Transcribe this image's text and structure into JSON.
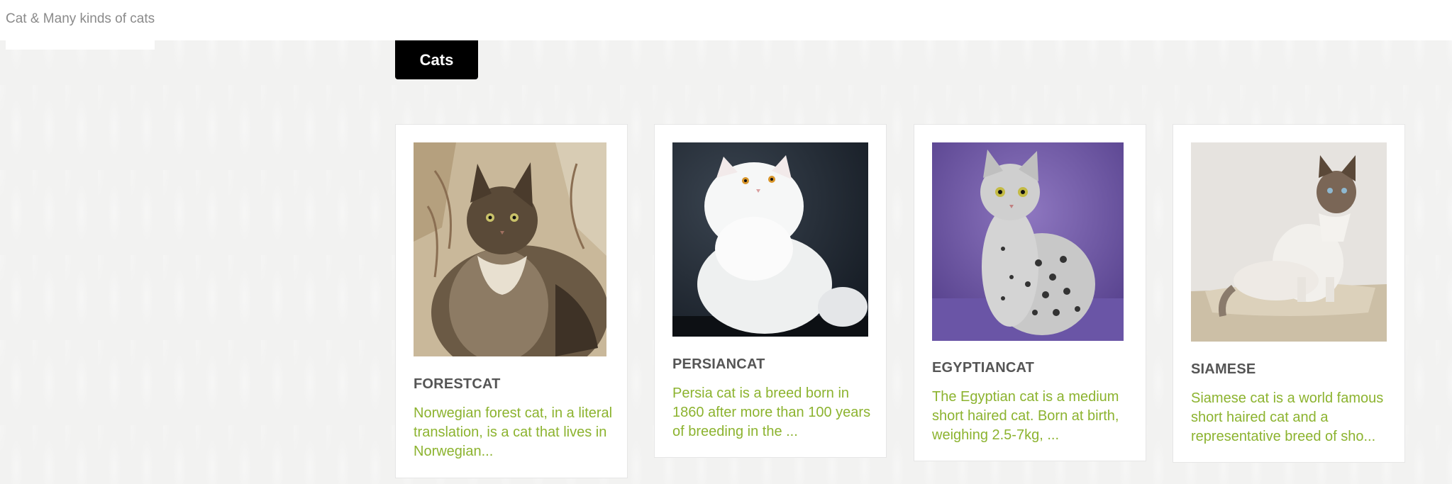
{
  "header": {
    "title": "Cat & Many kinds of cats"
  },
  "nav": {
    "active_tab": "Cats"
  },
  "cards": [
    {
      "name": "FORESTCAT",
      "image": "norwegian-forest-cat-photo",
      "desc": "Norwegian forest cat, in a literal translation, is a cat that lives in Norwegian..."
    },
    {
      "name": "PERSIANCAT",
      "image": "persian-cat-photo",
      "desc": "Persia cat is a breed born in 1860 after more than 100 years of breeding in the ..."
    },
    {
      "name": "EGYPTIANCAT",
      "image": "egyptian-mau-cat-photo",
      "desc": "The Egyptian cat is a medium short haired cat. Born at birth, weighing 2.5-7kg, ..."
    },
    {
      "name": "SIAMESE",
      "image": "siamese-cat-photo",
      "desc": "Siamese cat is a world famous short haired cat and a representative breed of sho..."
    }
  ],
  "colors": {
    "accent_text": "#8cb32f",
    "button_bg": "#000000",
    "title_text": "#555555"
  }
}
